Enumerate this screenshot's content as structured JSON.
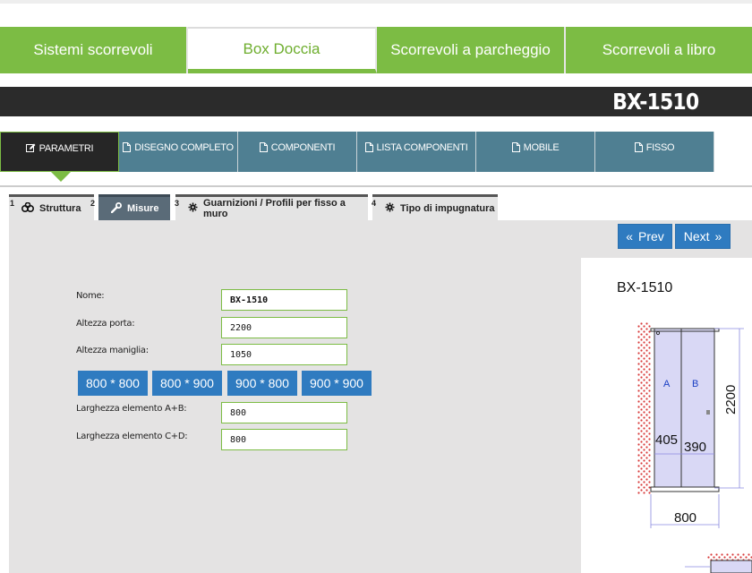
{
  "category_tabs": [
    {
      "label": "Sistemi scorrevoli",
      "active": false
    },
    {
      "label": "Box Doccia",
      "active": true
    },
    {
      "label": "Scorrevoli a parcheggio",
      "active": false
    },
    {
      "label": "Scorrevoli a libro",
      "active": false
    }
  ],
  "model": {
    "title": "BX-1510"
  },
  "section_tabs": [
    {
      "label": "PARAMETRI",
      "icon": "edit-icon",
      "active": true
    },
    {
      "label": "DISEGNO COMPLETO",
      "icon": "document-icon",
      "active": false
    },
    {
      "label": "COMPONENTI",
      "icon": "document-icon",
      "active": false
    },
    {
      "label": "LISTA COMPONENTI",
      "icon": "document-icon",
      "active": false
    },
    {
      "label": "MOBILE",
      "icon": "document-icon",
      "active": false
    },
    {
      "label": "FISSO",
      "icon": "document-icon",
      "active": false
    }
  ],
  "step_tabs": [
    {
      "num": "1",
      "label": "Struttura",
      "icon": "cubes-icon",
      "active": false
    },
    {
      "num": "2",
      "label": "Misure",
      "icon": "wrench-icon",
      "active": true
    },
    {
      "num": "3",
      "label": "Guarnizioni / Profili per fisso a muro",
      "icon": "gear-icon",
      "active": false
    },
    {
      "num": "4",
      "label": "Tipo di impugnatura",
      "icon": "gear-icon",
      "active": false
    }
  ],
  "nav": {
    "prev_label": "Prev",
    "next_label": "Next"
  },
  "form": {
    "name_label": "Nome:",
    "name_value": "BX-1510",
    "door_height_label": "Altezza porta:",
    "door_height_value": "2200",
    "handle_height_label": "Altezza maniglia:",
    "handle_height_value": "1050",
    "width_ab_label": "Larghezza elemento A+B:",
    "width_ab_value": "800",
    "width_cd_label": "Larghezza elemento C+D:",
    "width_cd_value": "800"
  },
  "size_presets": [
    "800 * 800",
    "800 * 900",
    "900 * 800",
    "900 * 900"
  ],
  "drawing": {
    "title": "BX-1510",
    "panel_a": "A",
    "panel_b": "B",
    "height": "2200",
    "width_a": "405",
    "width_b": "390",
    "total_width": "800"
  },
  "colors": {
    "green": "#7cbc44",
    "dark": "#2b2b2b",
    "steel_blue": "#4f7f92",
    "button_blue": "#2f7bc0",
    "panel_gray": "#e4e3e3"
  }
}
